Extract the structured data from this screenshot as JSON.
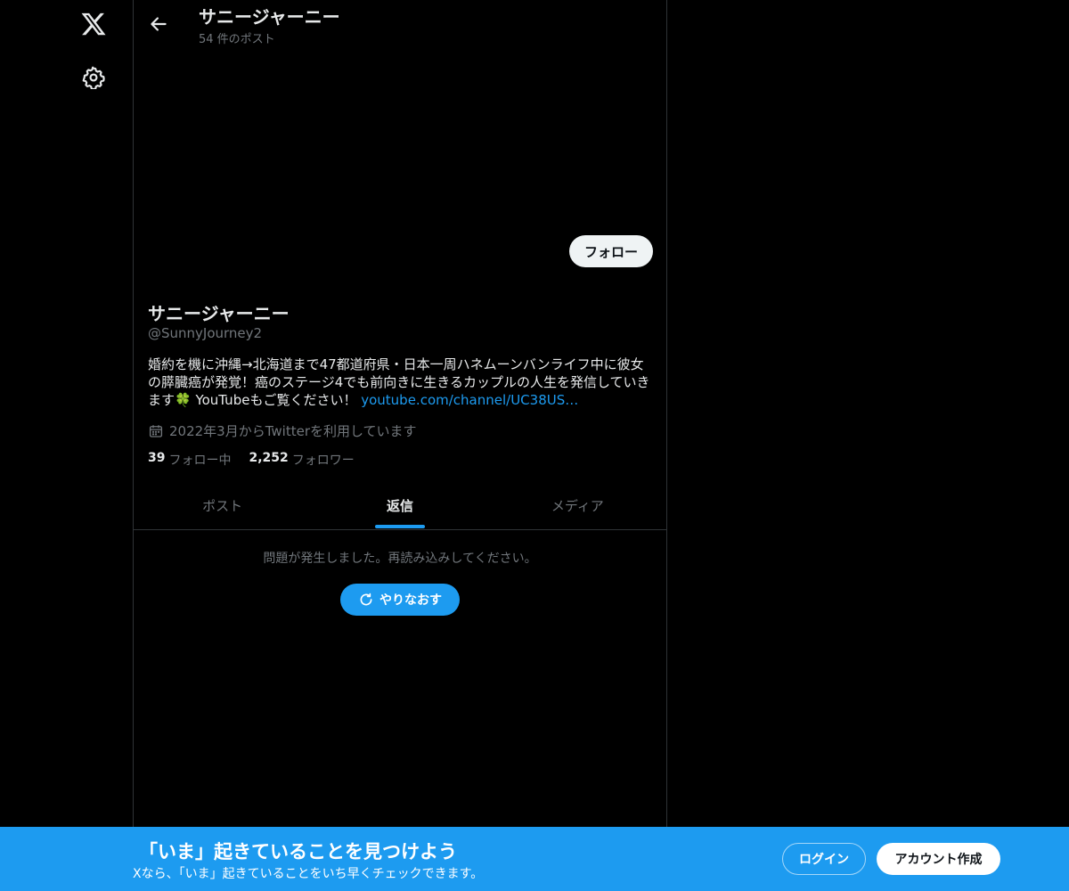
{
  "nav": {
    "logo_icon": "x-logo-icon",
    "settings_icon": "gear-icon"
  },
  "header": {
    "back_icon": "arrow-left-icon",
    "title": "サニージャーニー",
    "post_count": "54 件のポスト"
  },
  "profile": {
    "follow_label": "フォロー",
    "name": "サニージャーニー",
    "handle": "@SunnyJourney2",
    "bio_line1": "婚約を機に沖縄→北海道まで47都道府県・日本一周ハネムーンバンライフ中に彼女",
    "bio_line2": "の膵臓癌が発覚！癌のステージ4でも前向きに生きるカップルの人生を発信していき",
    "bio_line3": "ます🍀 YouTubeもご覧ください！",
    "bio_link": "youtube.com/channel/UC38US…",
    "joined": "2022年3月からTwitterを利用しています",
    "following_count": "39",
    "following_label": "フォロー中",
    "followers_count": "2,252",
    "followers_label": "フォロワー"
  },
  "tabs": [
    {
      "label": "ポスト",
      "active": false
    },
    {
      "label": "返信",
      "active": true
    },
    {
      "label": "メディア",
      "active": false
    }
  ],
  "error": {
    "message": "問題が発生しました。再読み込みしてください。",
    "retry_label": "やりなおす"
  },
  "bottom_bar": {
    "title": "「いま」起きていることを見つけよう",
    "subtitle": "Xなら、「いま」起きていることをいち早くチェックできます。",
    "login_label": "ログイン",
    "signup_label": "アカウント作成"
  },
  "colors": {
    "accent": "#1d9bf0",
    "background": "#000000",
    "text": "#e7e9ea",
    "muted": "#71767b"
  }
}
